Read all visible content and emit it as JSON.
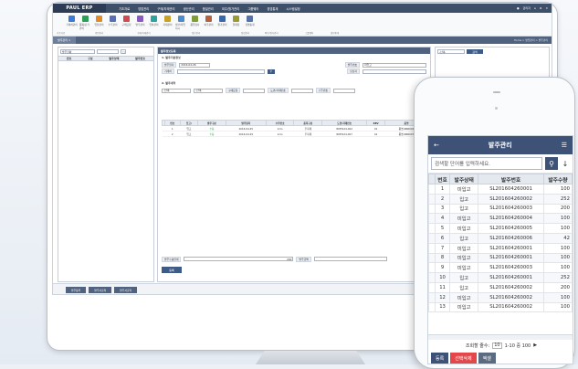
{
  "app": {
    "logo": "PAUL ERP",
    "menu": [
      "기초자료",
      "영업관리",
      "구매/자재관리",
      "생산관리",
      "품질관리",
      "외주/원가관리",
      "그룹웨어",
      "경영통계",
      "시스템설정"
    ],
    "user": "관리자",
    "topicons": [
      "홈",
      "설정",
      "로그아웃"
    ]
  },
  "toolbar": {
    "buttons": [
      "거래처관리",
      "품목/단가관리",
      "입찰관리",
      "수주관리",
      "구매요청",
      "발주관리",
      "입하관리",
      "자재관리",
      "생산/작업지시",
      "품질검사",
      "외주관리",
      "원가관리",
      "결재함",
      "경영통계"
    ],
    "groups": [
      "기초자료",
      "영업관리",
      "구매/자재관리",
      "생산관리",
      "품질관리",
      "외주/원가관리",
      "그룹웨어",
      "경영통계"
    ]
  },
  "tabs": {
    "active": "발주관리",
    "breadcrumb": "Home > 영업관리 > 발주관리"
  },
  "left": {
    "select": "발주현황",
    "cols": [
      "번호",
      "구분",
      "발주상태",
      "발주번호"
    ]
  },
  "main": {
    "title": "발주정보등록",
    "sec1": "1. 발주기본정보",
    "l_date": "발주일자",
    "date": "2016-04-26",
    "l_no": "발주번호",
    "no_val": "미입고",
    "l_vendor": "거래처",
    "l_mgr": "담당자",
    "sec2": "2. 발주내역",
    "f_status": "-선택-",
    "f_type": "-선택-",
    "l_item": "구매요청",
    "l_draw": "도면/자재번호",
    "l_qty": "수주번호",
    "cols": [
      "번호",
      "입고/",
      "발주구분",
      "발주일자",
      "수주번호",
      "품목구분",
      "도면/자재번호",
      "REV",
      "품명"
    ],
    "rows": [
      [
        "1",
        "입고",
        "수동",
        "2016-04-25",
        "k-ho",
        "주자재",
        "RMH124-002",
        "01",
        "품명-RRR002"
      ],
      [
        "2",
        "입고",
        "수동",
        "2016-04-25",
        "k-ho",
        "주자재",
        "RMH124-007",
        "01",
        "품명-RRR007"
      ]
    ],
    "l_sumqty": "발주수량합계",
    "sumqty": "200",
    "l_amt": "발주금액",
    "save": "등록"
  },
  "right": {
    "select": "-선택-",
    "search": "검색"
  },
  "bottom": [
    "발주등록",
    "발주서출력",
    "발주서출력"
  ],
  "phone": {
    "title": "발주관리",
    "search_ph": "검색할 단어를 입력하세요.",
    "cols": [
      "번호",
      "발주상태",
      "발주번호",
      "발주수량"
    ],
    "rows": [
      [
        "1",
        "미입고",
        "SL201604260001",
        "100"
      ],
      [
        "2",
        "입고",
        "SL201604260002",
        "252"
      ],
      [
        "3",
        "입고",
        "SL201604260003",
        "200"
      ],
      [
        "4",
        "미입고",
        "SL201604260004",
        "100"
      ],
      [
        "5",
        "미입고",
        "SL201604260005",
        "100"
      ],
      [
        "6",
        "입고",
        "SL201604260006",
        "42"
      ],
      [
        "7",
        "미입고",
        "SL201604260001",
        "100"
      ],
      [
        "8",
        "미입고",
        "SL201604260001",
        "100"
      ],
      [
        "9",
        "미입고",
        "SL201604260003",
        "100"
      ],
      [
        "10",
        "입고",
        "SL201604260001",
        "252"
      ],
      [
        "11",
        "입고",
        "SL201604260002",
        "200"
      ],
      [
        "12",
        "미입고",
        "SL201604260002",
        "100"
      ],
      [
        "13",
        "미입고",
        "SL201604260002",
        "100"
      ]
    ],
    "pager_label": "조회할 줄수:",
    "pager_size": "10",
    "pager_range": "1-10 중 100",
    "btns": [
      "등록",
      "선택삭제",
      "엑셀"
    ]
  },
  "colors": {
    "nav": "#3e4f6a",
    "accent": "#3e5177",
    "danger": "#e4474a"
  }
}
